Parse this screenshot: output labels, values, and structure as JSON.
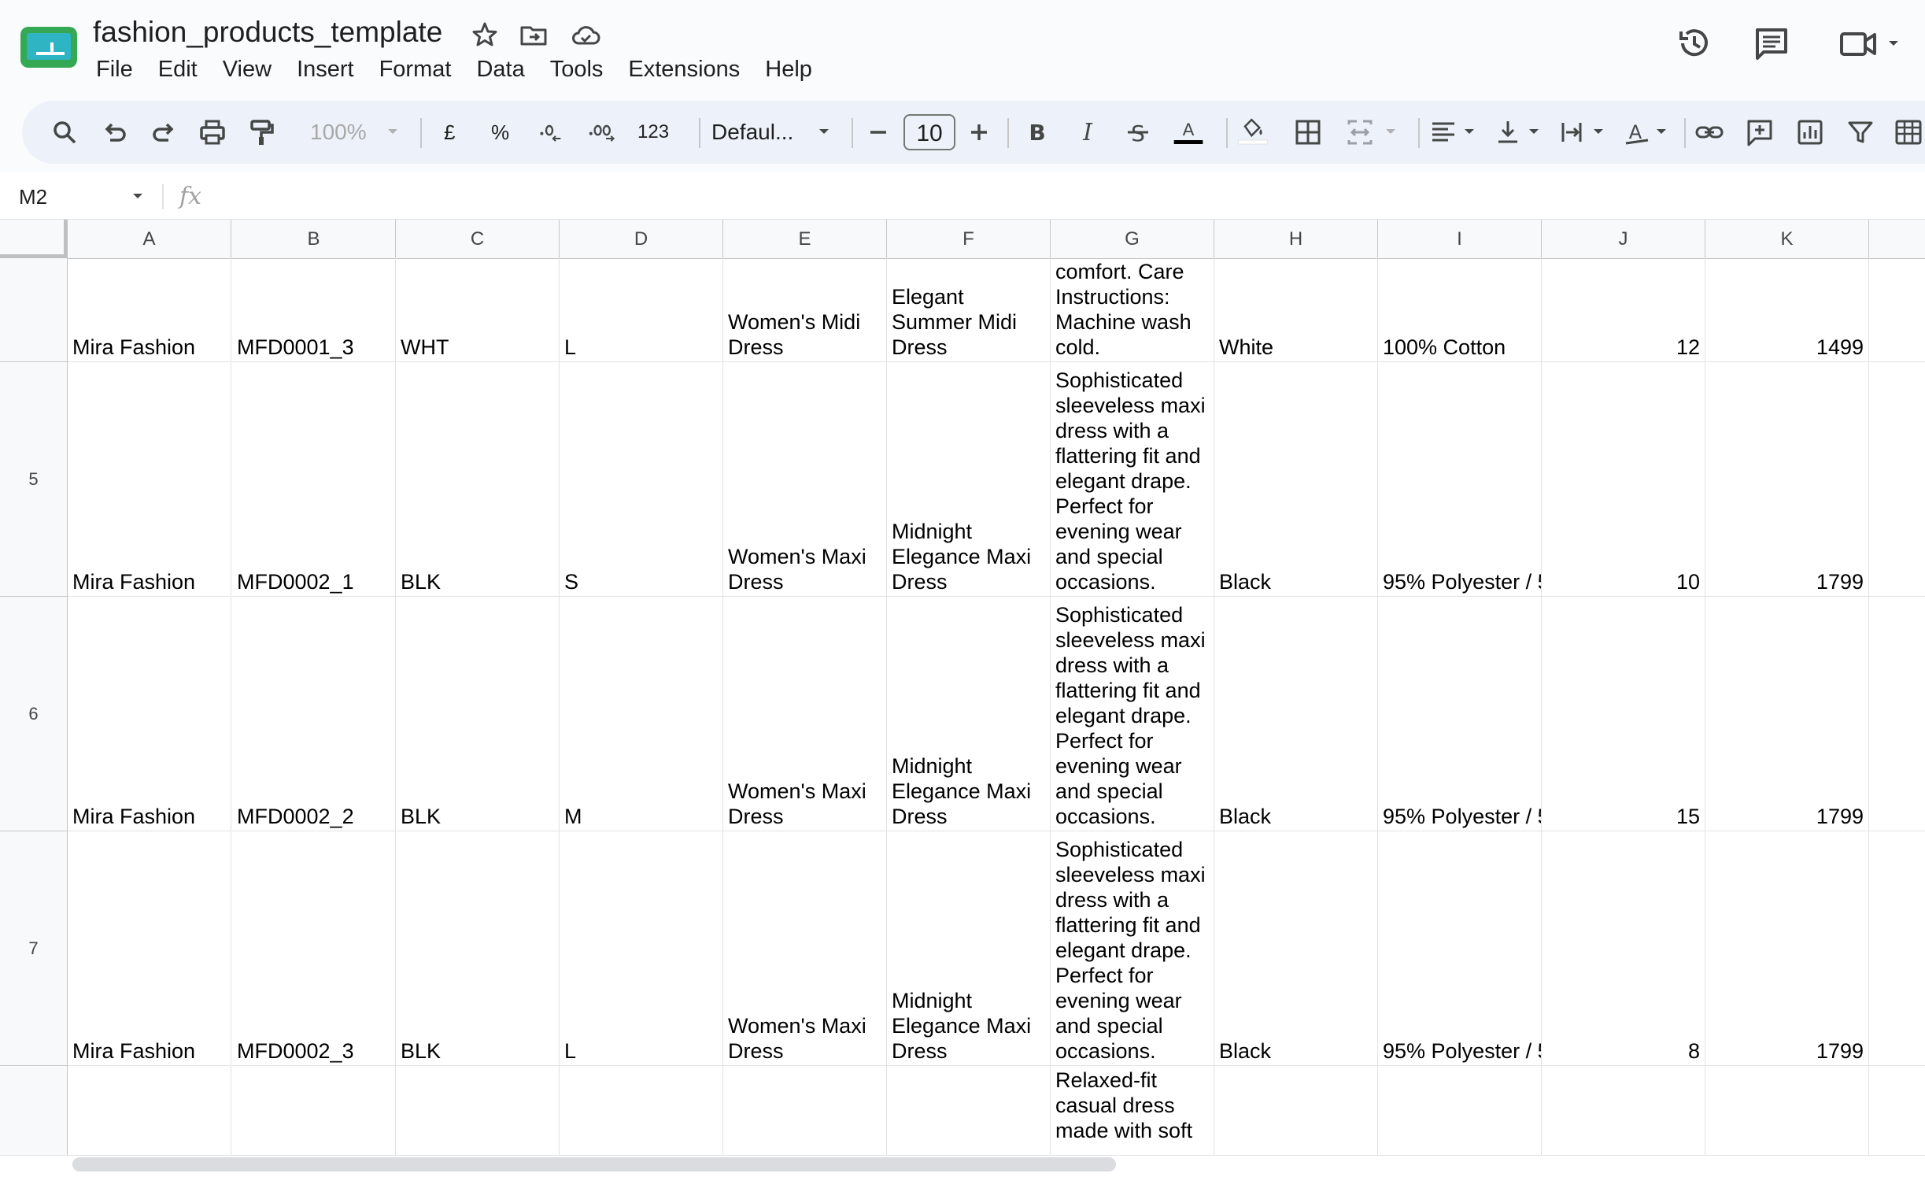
{
  "app": {
    "doc_title": "fashion_products_template",
    "menu": [
      "File",
      "Edit",
      "View",
      "Insert",
      "Format",
      "Data",
      "Tools",
      "Extensions",
      "Help"
    ]
  },
  "toolbar": {
    "zoom": "100%",
    "currency": "£",
    "percent": "%",
    "dec_decrease": ".0",
    "dec_increase": ".00",
    "number_format": "123",
    "font": "Defaul...",
    "font_size": "10",
    "minus": "−",
    "plus": "+"
  },
  "formula_bar": {
    "cell_ref": "M2",
    "fx": "fx",
    "value": ""
  },
  "colors": {
    "accent_green": "#0f9d58",
    "menu_bg": "#f9fbfd",
    "toolbar_bg": "#edf2fa",
    "header_bg": "#f8f9fa",
    "text_color_bar": "#000000"
  },
  "grid": {
    "columns": [
      "A",
      "B",
      "C",
      "D",
      "E",
      "F",
      "G",
      "H",
      "I",
      "J",
      "K"
    ],
    "rows": [
      {
        "num": "",
        "cells": [
          "Mira Fashion",
          "MFD0001_3",
          "WHT",
          "L",
          "Women's Midi Dress",
          "Elegant Summer Midi Dress",
          "comfort. Care Instructions: Machine wash cold.",
          "White",
          "100% Cotton",
          "12",
          "1499"
        ]
      },
      {
        "num": "5",
        "cells": [
          "Mira Fashion",
          "MFD0002_1",
          "BLK",
          "S",
          "Women's Maxi Dress",
          "Midnight Elegance Maxi Dress",
          "Sophisticated sleeveless maxi dress with a flattering fit and elegant drape. Perfect for evening wear and special occasions.",
          "Black",
          "95% Polyester / 5",
          "10",
          "1799"
        ]
      },
      {
        "num": "6",
        "cells": [
          "Mira Fashion",
          "MFD0002_2",
          "BLK",
          "M",
          "Women's Maxi Dress",
          "Midnight Elegance Maxi Dress",
          "Sophisticated sleeveless maxi dress with a flattering fit and elegant drape. Perfect for evening wear and special occasions.",
          "Black",
          "95% Polyester / 5",
          "15",
          "1799"
        ]
      },
      {
        "num": "7",
        "cells": [
          "Mira Fashion",
          "MFD0002_3",
          "BLK",
          "L",
          "Women's Maxi Dress",
          "Midnight Elegance Maxi Dress",
          "Sophisticated sleeveless maxi dress with a flattering fit and elegant drape. Perfect for evening wear and special occasions.",
          "Black",
          "95% Polyester / 5",
          "8",
          "1799"
        ]
      },
      {
        "num": "",
        "cells": [
          "",
          "",
          "",
          "",
          "",
          "",
          "Relaxed-fit casual dress made with soft",
          "",
          "",
          "",
          ""
        ]
      }
    ]
  }
}
